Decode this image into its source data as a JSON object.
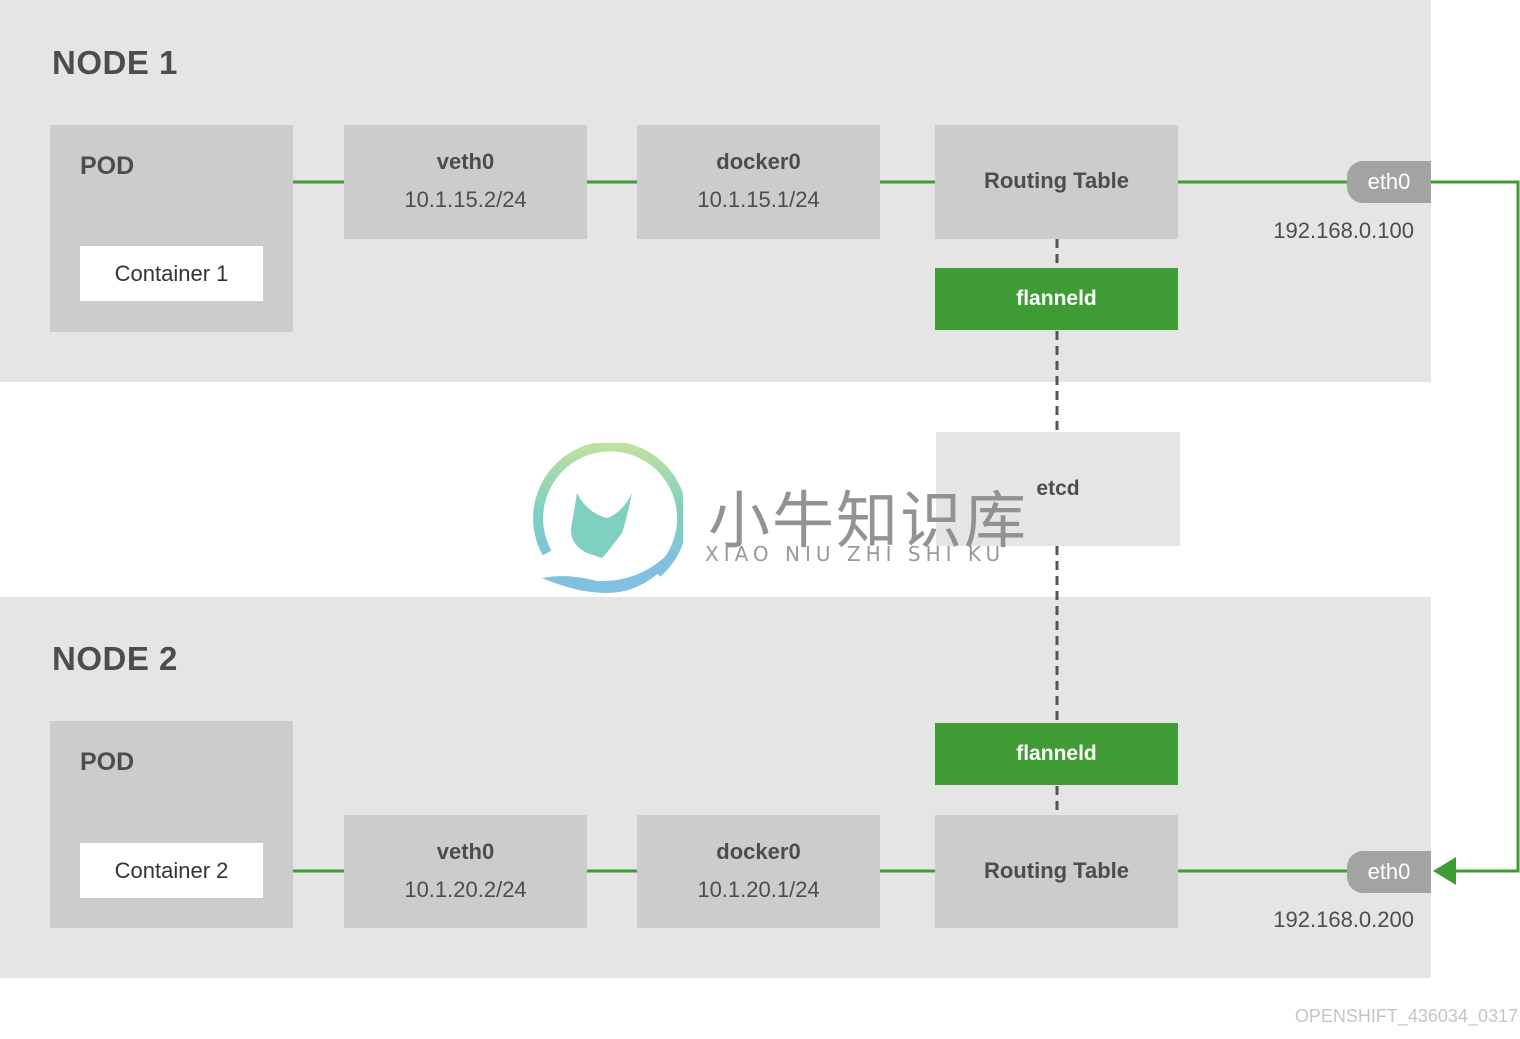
{
  "colors": {
    "green": "#3f9c35",
    "box_gray": "#cccccc",
    "node_bg": "#e5e5e5",
    "eth_gray": "#a3a3a3",
    "text_dark": "#4d4d4d"
  },
  "node1": {
    "title": "NODE 1",
    "pod_label": "POD",
    "container": "Container 1",
    "veth": {
      "name": "veth0",
      "ip": "10.1.15.2/24"
    },
    "docker": {
      "name": "docker0",
      "ip": "10.1.15.1/24"
    },
    "routing_table": "Routing Table",
    "flanneld": "flanneld",
    "eth": "eth0",
    "eth_ip": "192.168.0.100"
  },
  "node2": {
    "title": "NODE 2",
    "pod_label": "POD",
    "container": "Container 2",
    "veth": {
      "name": "veth0",
      "ip": "10.1.20.2/24"
    },
    "docker": {
      "name": "docker0",
      "ip": "10.1.20.1/24"
    },
    "routing_table": "Routing Table",
    "flanneld": "flanneld",
    "eth": "eth0",
    "eth_ip": "192.168.0.200"
  },
  "etcd": "etcd",
  "watermark": {
    "cn": "小牛知识库",
    "en": "XIAO NIU ZHI SHI KU"
  },
  "footer": "OPENSHIFT_436034_0317"
}
